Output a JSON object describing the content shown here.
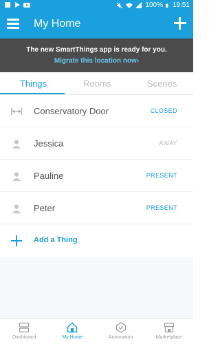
{
  "status_bar": {
    "battery": "100%",
    "time": "19:51",
    "icons": [
      "notification-icon",
      "play-store-icon",
      "youtube-icon",
      "mute-icon",
      "wifi-icon",
      "signal-icon",
      "battery-icon"
    ]
  },
  "app_bar": {
    "title": "My Home",
    "icons": [
      "menu-icon",
      "plus-icon"
    ]
  },
  "banner": {
    "message": "The new SmartThings app is ready for you.",
    "link": "Migrate this location now›"
  },
  "tabs": [
    {
      "label": "Things",
      "active": true
    },
    {
      "label": "Rooms",
      "active": false
    },
    {
      "label": "Scenes",
      "active": false
    }
  ],
  "things": [
    {
      "icon": "door-sensor-icon",
      "name": "Conservatory Door",
      "status": "CLOSED",
      "status_color": "#1aa0dc"
    },
    {
      "icon": "person-icon",
      "name": "Jessica",
      "status": "AWAY",
      "status_color": "#bdbdbd"
    },
    {
      "icon": "person-icon",
      "name": "Pauline",
      "status": "PRESENT",
      "status_color": "#1aa0dc"
    },
    {
      "icon": "person-icon",
      "name": "Peter",
      "status": "PRESENT",
      "status_color": "#1aa0dc"
    }
  ],
  "add_thing": {
    "label": "Add a Thing",
    "icon": "plus-icon"
  },
  "bottom_nav": [
    {
      "label": "Dashboard",
      "icon": "dashboard-icon",
      "active": false
    },
    {
      "label": "My Home",
      "icon": "home-icon",
      "active": true
    },
    {
      "label": "Automation",
      "icon": "automation-icon",
      "active": false
    },
    {
      "label": "Marketplace",
      "icon": "marketplace-icon",
      "active": false
    }
  ],
  "colors": {
    "accent": "#1aa0dc",
    "banner_bg": "#4b4b4b",
    "banner_link": "#69c7f0",
    "inactive": "#bdbdbd"
  }
}
